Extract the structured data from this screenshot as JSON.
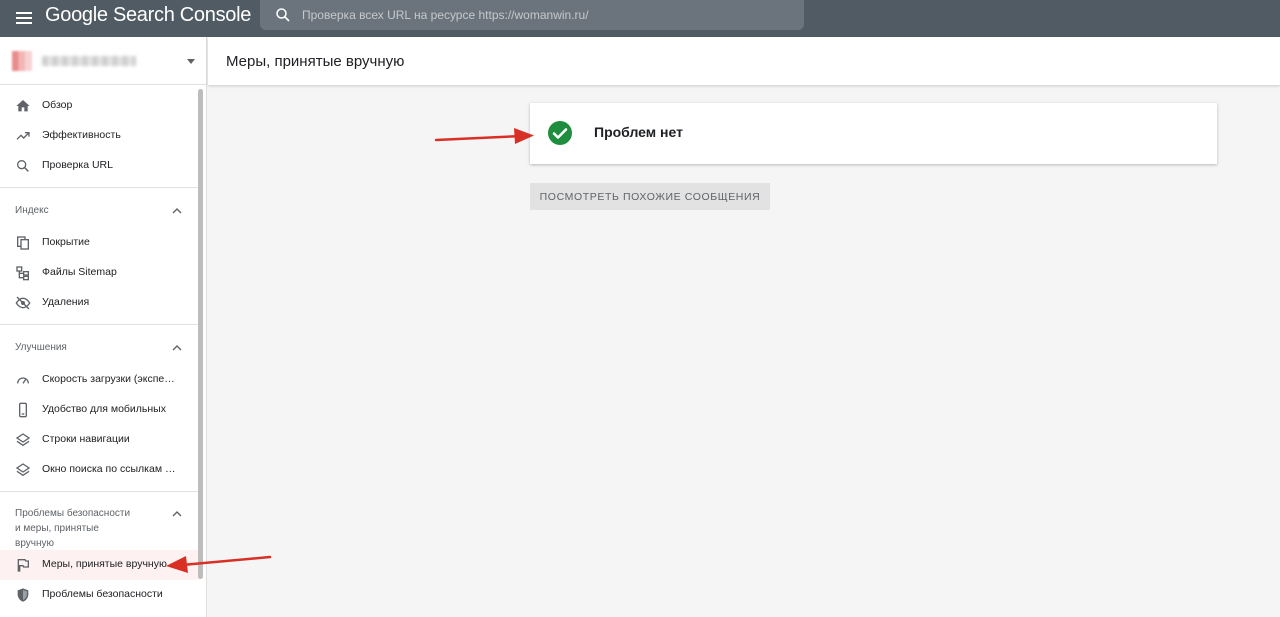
{
  "app": {
    "title": "Google Search Console"
  },
  "search": {
    "placeholder": "Проверка всех URL на ресурсе https://womanwin.ru/"
  },
  "sidebar": {
    "top_items": [
      {
        "label": "Обзор",
        "icon": "home-icon"
      },
      {
        "label": "Эффективность",
        "icon": "trending-up-icon"
      },
      {
        "label": "Проверка URL",
        "icon": "search-icon"
      }
    ],
    "index": {
      "title": "Индекс",
      "items": [
        {
          "label": "Покрытие",
          "icon": "copy-icon"
        },
        {
          "label": "Файлы Sitemap",
          "icon": "sitemap-icon"
        },
        {
          "label": "Удаления",
          "icon": "eye-off-icon"
        }
      ]
    },
    "enhancements": {
      "title": "Улучшения",
      "items": [
        {
          "label": "Скорость загрузки (экспер…",
          "icon": "speed-icon"
        },
        {
          "label": "Удобство для мобильных",
          "icon": "phone-icon"
        },
        {
          "label": "Строки навигации",
          "icon": "layers-icon"
        },
        {
          "label": "Окно поиска по ссылкам с…",
          "icon": "layers-icon"
        }
      ]
    },
    "security": {
      "title_line1": "Проблемы безопасности",
      "title_line2": "и меры, принятые",
      "title_line3": "вручную",
      "items": [
        {
          "label": "Меры, принятые вручную",
          "icon": "flag-icon",
          "active": true
        },
        {
          "label": "Проблемы безопасности",
          "icon": "shield-icon"
        }
      ]
    }
  },
  "main": {
    "title": "Меры, принятые вручную",
    "status_text": "Проблем нет",
    "similar_button": "ПОСМОТРЕТЬ ПОХОЖИЕ СООБЩЕНИЯ"
  },
  "colors": {
    "topbar": "#515b64",
    "success": "#1e8e3e",
    "arrow": "#d93025"
  }
}
